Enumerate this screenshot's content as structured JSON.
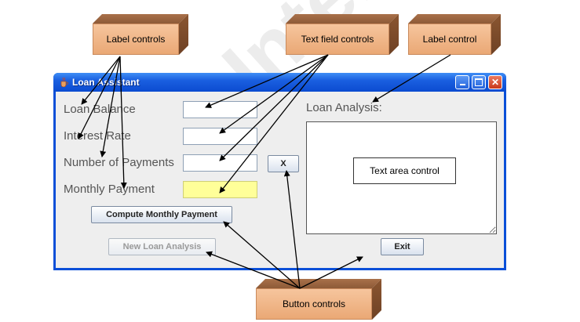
{
  "callouts": {
    "label_controls": "Label controls",
    "text_field_controls": "Text field controls",
    "label_control": "Label control",
    "text_area_control": "Text area control",
    "button_controls": "Button controls"
  },
  "window": {
    "title": "Loan Assistant",
    "icon": "java-cup-icon",
    "buttons": [
      "minimize-icon",
      "maximize-icon",
      "close-icon"
    ],
    "close_glyph": "✕"
  },
  "form": {
    "loan_balance_label": "Loan Balance",
    "interest_rate_label": "Interest Rate",
    "num_payments_label": "Number of Payments",
    "monthly_payment_label": "Monthly Payment",
    "loan_balance_value": "",
    "interest_rate_value": "",
    "num_payments_value": "",
    "monthly_payment_value": "",
    "x_button": "X",
    "compute_button": "Compute Monthly Payment",
    "new_analysis_button": "New Loan Analysis",
    "exit_button": "Exit",
    "analysis_label": "Loan Analysis:"
  },
  "colors": {
    "callout_face": "#eaa875",
    "titlebar": "#1a5fe0",
    "monthly_payment_field": "#ffff99"
  },
  "watermark": "en Internship"
}
